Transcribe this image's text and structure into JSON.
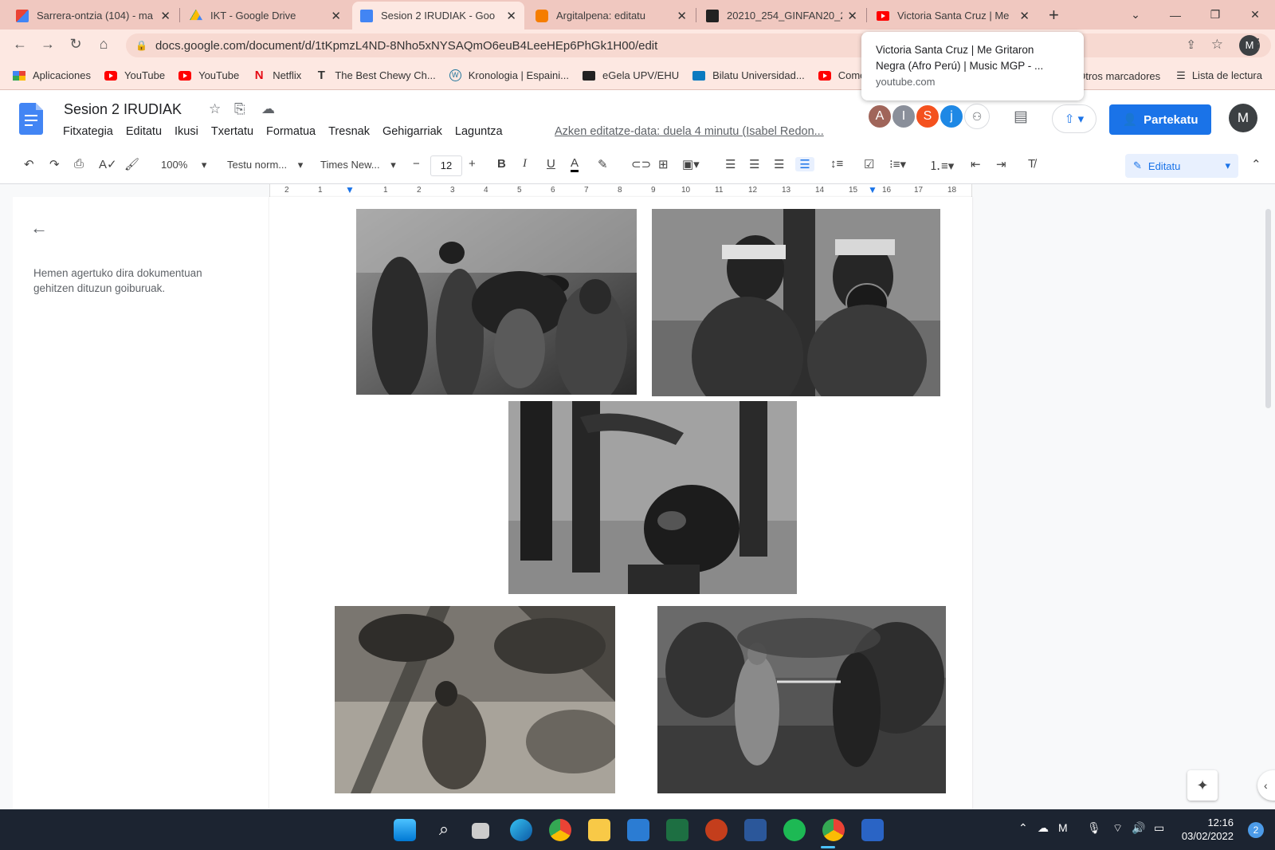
{
  "tabs": [
    {
      "label": "Sarrera-ontzia (104) - ma",
      "icon": "gmail-icon",
      "color": "#ea4335"
    },
    {
      "label": "IKT - Google Drive",
      "icon": "drive-icon",
      "color": "#fbbc04"
    },
    {
      "label": "Sesion 2 IRUDIAK - Goo",
      "icon": "docs-icon",
      "color": "#4285f4",
      "active": true
    },
    {
      "label": "Argitalpena: editatu",
      "icon": "blogger-icon",
      "color": "#f57d00"
    },
    {
      "label": "20210_254_GINFAN20_2",
      "icon": "egela-icon",
      "color": "#222222"
    },
    {
      "label": "Victoria Santa Cruz | Me",
      "icon": "youtube-icon",
      "color": "#ff0000"
    }
  ],
  "url": "docs.google.com/document/d/1tKpmzL4ND-8Nho5xNYSAQmO6euB4LeeHEp6PhGk1H00/edit",
  "bookmarks": [
    {
      "label": "Aplicaciones",
      "icon": "apps-grid-icon"
    },
    {
      "label": "YouTube",
      "icon": "youtube-icon"
    },
    {
      "label": "YouTube",
      "icon": "youtube-icon"
    },
    {
      "label": "Netflix",
      "icon": "netflix-icon"
    },
    {
      "label": "The Best Chewy Ch...",
      "icon": "t-icon"
    },
    {
      "label": "Kronologia | Espaini...",
      "icon": "wordpress-icon"
    },
    {
      "label": "eGela UPV/EHU",
      "icon": "egela-icon"
    },
    {
      "label": "Bilatu Universidad...",
      "icon": "bilatu-icon"
    },
    {
      "label": "Como ",
      "icon": "youtube-icon"
    }
  ],
  "bookmarks_right": {
    "others": "Otros marcadores",
    "reading_list": "Lista de lectura"
  },
  "tooltip": {
    "line1": "Victoria Santa Cruz | Me Gritaron",
    "line2": "Negra (Afro Perú) | Music MGP - ...",
    "url": "youtube.com"
  },
  "doc": {
    "title": "Sesion 2 IRUDIAK",
    "menu": [
      "Fitxategia",
      "Editatu",
      "Ikusi",
      "Txertatu",
      "Formatua",
      "Tresnak",
      "Gehigarriak",
      "Laguntza"
    ],
    "last_edit": "Azken editatze-data: duela 4 minutu (Isabel Redon...",
    "share_label": "Partekatu",
    "avatars": [
      {
        "letter": "A",
        "color": "#a0655a"
      },
      {
        "letter": "I",
        "color": "#8a8f9a"
      },
      {
        "letter": "S",
        "color": "#f4511e"
      },
      {
        "letter": "j",
        "color": "#1e88e5"
      }
    ],
    "user_initial": "M"
  },
  "toolbar": {
    "zoom": "100%",
    "style": "Testu norm...",
    "font": "Times New...",
    "font_size": "12",
    "mode": "Editatu"
  },
  "ruler_marks": [
    "2",
    "1",
    "1",
    "2",
    "3",
    "4",
    "5",
    "6",
    "7",
    "8",
    "9",
    "10",
    "11",
    "12",
    "13",
    "14",
    "15",
    "16",
    "17",
    "18"
  ],
  "outline_text": "Hemen agertuko dira dokumentuan gehitzen dituzun goiburuak.",
  "taskbar": {
    "time": "12:16",
    "date": "03/02/2022",
    "notifications": "2"
  }
}
